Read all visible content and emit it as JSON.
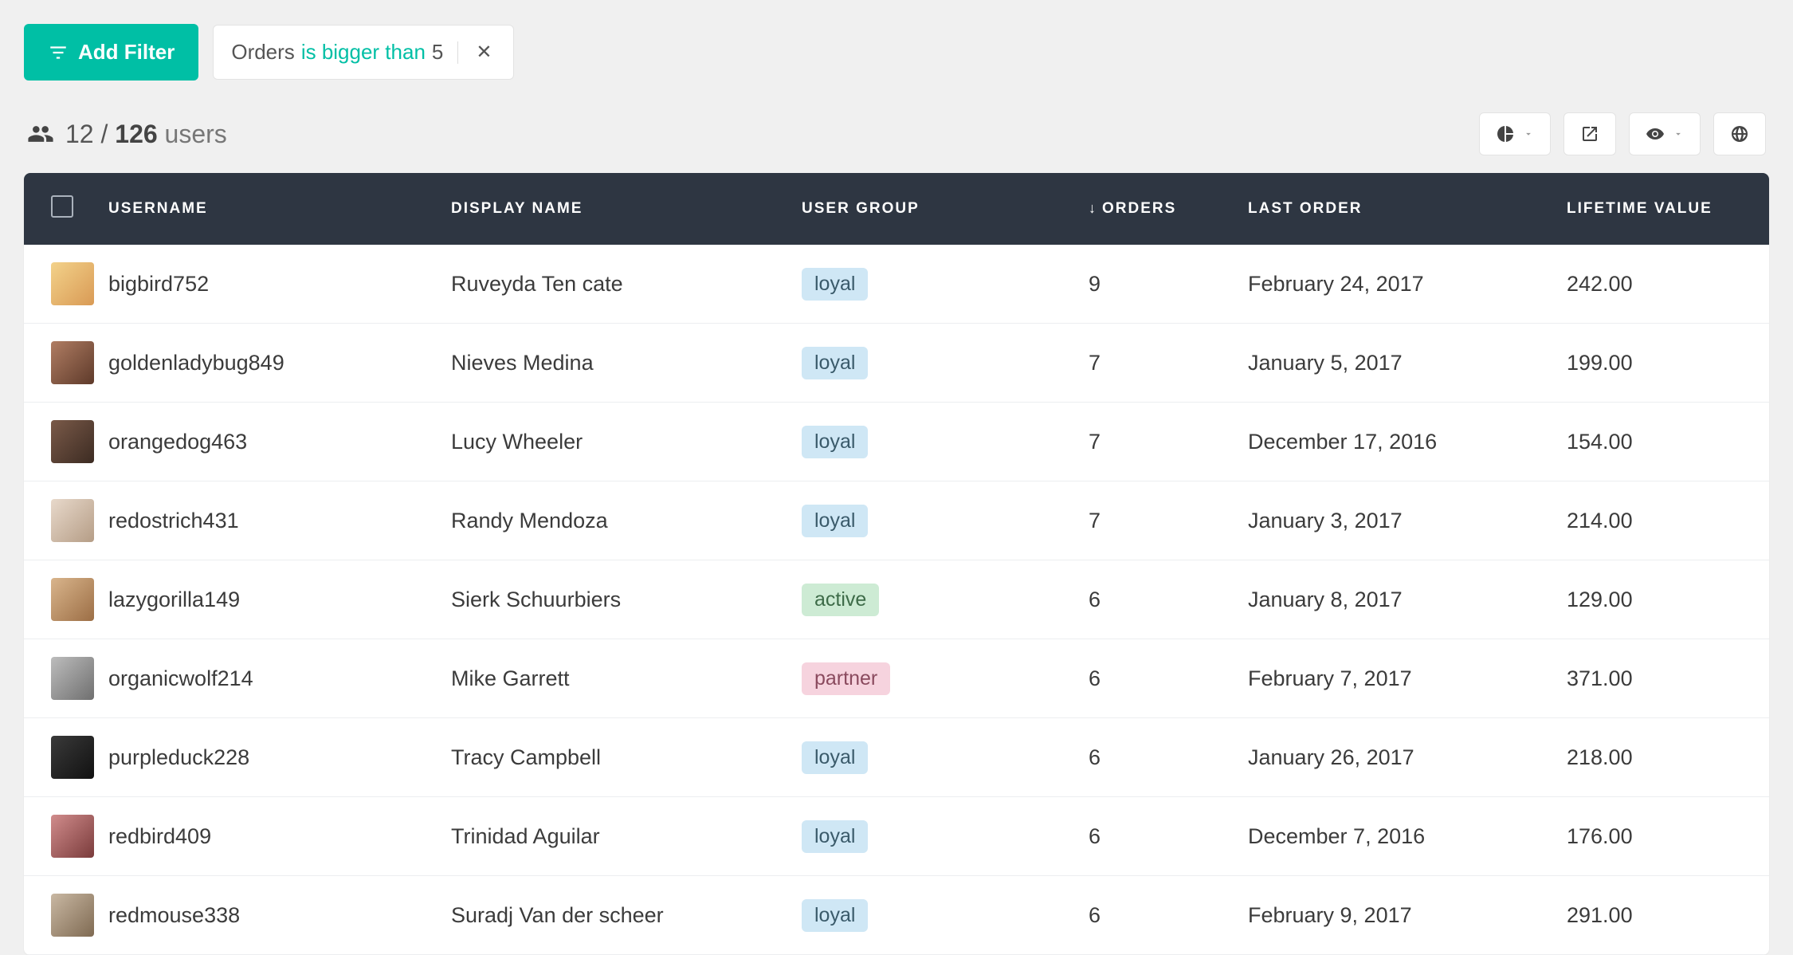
{
  "filters": {
    "add_label": "Add Filter",
    "chip": {
      "field": "Orders",
      "operator": "is bigger than",
      "value": "5"
    }
  },
  "summary": {
    "shown": "12",
    "separator": "/",
    "total": "126",
    "label": "users"
  },
  "columns": {
    "username": "USERNAME",
    "display_name": "DISPLAY NAME",
    "user_group": "USER GROUP",
    "orders": "ORDERS",
    "last_order": "LAST ORDER",
    "lifetime_value": "LIFETIME VALUE",
    "sort_indicator": "↓"
  },
  "group_labels": {
    "loyal": "loyal",
    "active": "active",
    "partner": "partner"
  },
  "rows": [
    {
      "username": "bigbird752",
      "display_name": "Ruveyda Ten cate",
      "group": "loyal",
      "orders": "9",
      "last_order": "February 24, 2017",
      "lifetime_value": "242.00"
    },
    {
      "username": "goldenladybug849",
      "display_name": "Nieves Medina",
      "group": "loyal",
      "orders": "7",
      "last_order": "January 5, 2017",
      "lifetime_value": "199.00"
    },
    {
      "username": "orangedog463",
      "display_name": "Lucy Wheeler",
      "group": "loyal",
      "orders": "7",
      "last_order": "December 17, 2016",
      "lifetime_value": "154.00"
    },
    {
      "username": "redostrich431",
      "display_name": "Randy Mendoza",
      "group": "loyal",
      "orders": "7",
      "last_order": "January 3, 2017",
      "lifetime_value": "214.00"
    },
    {
      "username": "lazygorilla149",
      "display_name": "Sierk Schuurbiers",
      "group": "active",
      "orders": "6",
      "last_order": "January 8, 2017",
      "lifetime_value": "129.00"
    },
    {
      "username": "organicwolf214",
      "display_name": "Mike Garrett",
      "group": "partner",
      "orders": "6",
      "last_order": "February 7, 2017",
      "lifetime_value": "371.00"
    },
    {
      "username": "purpleduck228",
      "display_name": "Tracy Campbell",
      "group": "loyal",
      "orders": "6",
      "last_order": "January 26, 2017",
      "lifetime_value": "218.00"
    },
    {
      "username": "redbird409",
      "display_name": "Trinidad Aguilar",
      "group": "loyal",
      "orders": "6",
      "last_order": "December 7, 2016",
      "lifetime_value": "176.00"
    },
    {
      "username": "redmouse338",
      "display_name": "Suradj Van der scheer",
      "group": "loyal",
      "orders": "6",
      "last_order": "February 9, 2017",
      "lifetime_value": "291.00"
    }
  ]
}
